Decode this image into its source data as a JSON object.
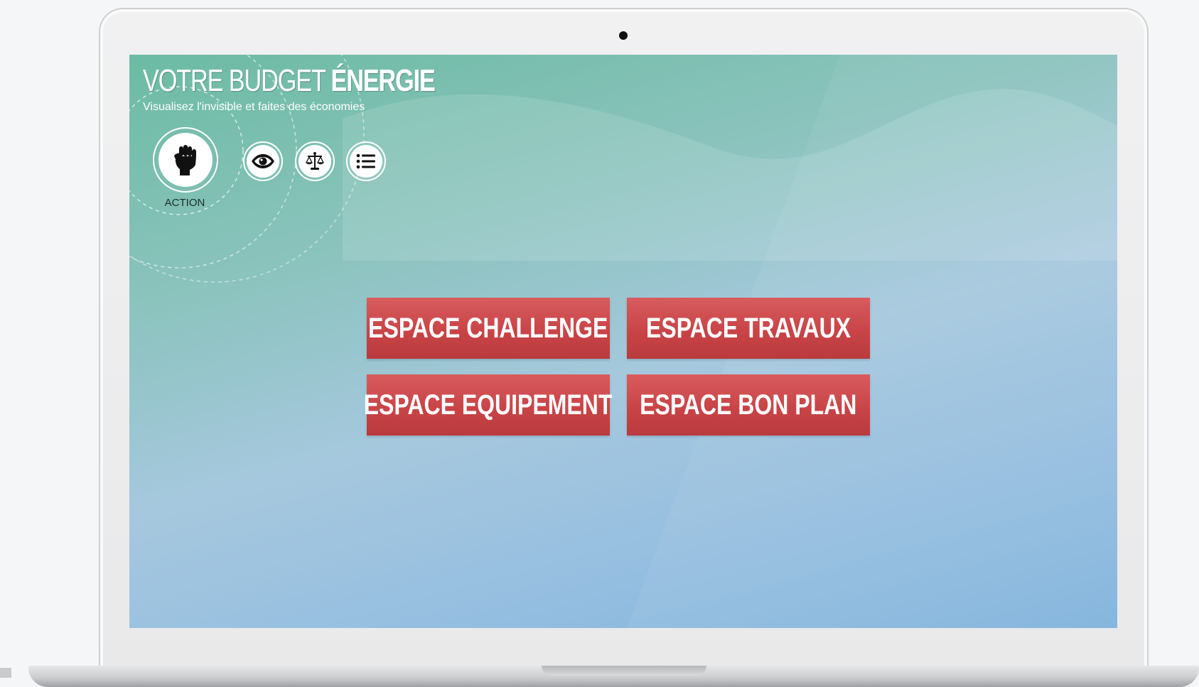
{
  "app": {
    "title_light": "VOTRE BUDGET ",
    "title_bold": "ÉNERGIE",
    "subtitle": "Visualisez l'invisible et faites des économies"
  },
  "nav": {
    "active": {
      "label": "ACTION",
      "icon": "fist-icon"
    },
    "icons": [
      {
        "icon": "eye-icon"
      },
      {
        "icon": "scale-icon"
      },
      {
        "icon": "list-icon"
      }
    ]
  },
  "menu": {
    "buttons": [
      {
        "label": "ESPACE CHALLENGE"
      },
      {
        "label": "ESPACE TRAVAUX"
      },
      {
        "label": "ESPACE EQUIPEMENT"
      },
      {
        "label": "ESPACE BON PLAN"
      }
    ]
  },
  "colors": {
    "button": "#c94447",
    "screen_top": "#6cbba3",
    "screen_bottom": "#7fb2db"
  }
}
